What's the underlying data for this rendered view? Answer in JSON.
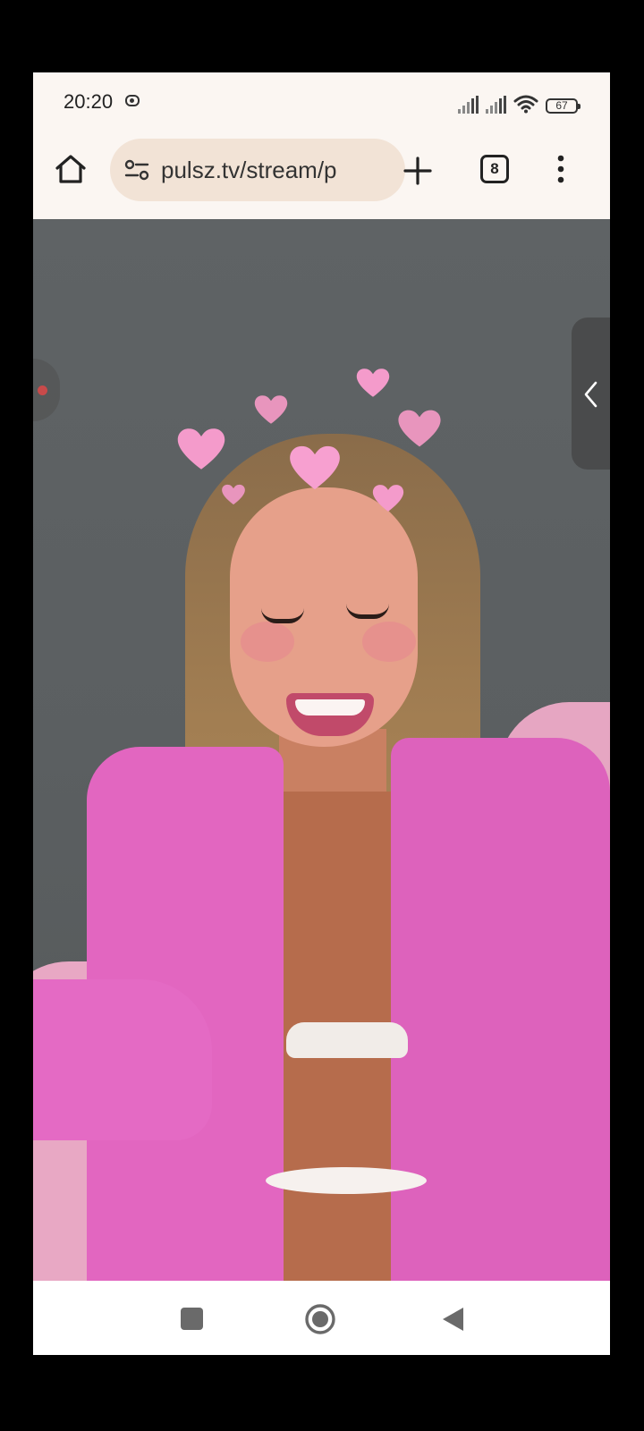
{
  "status_bar": {
    "time": "20:20",
    "battery": "67"
  },
  "browser": {
    "url": "pulsz.tv/stream/p",
    "tab_count": "8"
  },
  "icons": {
    "home": "home-icon",
    "site_settings": "tune-icon",
    "new_tab": "plus-icon",
    "tabs": "tab-switcher-icon",
    "menu": "more-vert-icon",
    "side_panel": "chevron-left-icon",
    "nav_recent": "square-icon",
    "nav_home": "circle-icon",
    "nav_back": "triangle-back-icon"
  },
  "colors": {
    "status_bg": "#fbf6f2",
    "url_bar_bg": "#f2e3d6",
    "video_bg": "#616567",
    "jacket": "#e266c0",
    "hearts": "#f49bcb",
    "nav_bg": "#ffffff"
  }
}
